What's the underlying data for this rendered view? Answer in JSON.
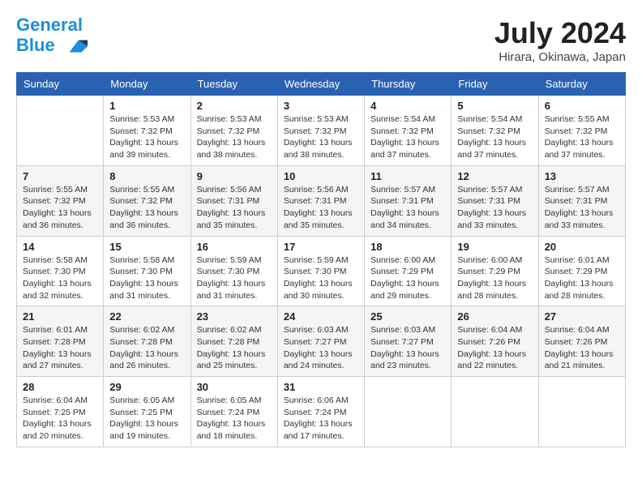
{
  "header": {
    "logo_line1": "General",
    "logo_line2": "Blue",
    "month": "July 2024",
    "location": "Hirara, Okinawa, Japan"
  },
  "weekdays": [
    "Sunday",
    "Monday",
    "Tuesday",
    "Wednesday",
    "Thursday",
    "Friday",
    "Saturday"
  ],
  "weeks": [
    [
      {
        "day": "",
        "info": ""
      },
      {
        "day": "1",
        "info": "Sunrise: 5:53 AM\nSunset: 7:32 PM\nDaylight: 13 hours\nand 39 minutes."
      },
      {
        "day": "2",
        "info": "Sunrise: 5:53 AM\nSunset: 7:32 PM\nDaylight: 13 hours\nand 38 minutes."
      },
      {
        "day": "3",
        "info": "Sunrise: 5:53 AM\nSunset: 7:32 PM\nDaylight: 13 hours\nand 38 minutes."
      },
      {
        "day": "4",
        "info": "Sunrise: 5:54 AM\nSunset: 7:32 PM\nDaylight: 13 hours\nand 37 minutes."
      },
      {
        "day": "5",
        "info": "Sunrise: 5:54 AM\nSunset: 7:32 PM\nDaylight: 13 hours\nand 37 minutes."
      },
      {
        "day": "6",
        "info": "Sunrise: 5:55 AM\nSunset: 7:32 PM\nDaylight: 13 hours\nand 37 minutes."
      }
    ],
    [
      {
        "day": "7",
        "info": "Sunrise: 5:55 AM\nSunset: 7:32 PM\nDaylight: 13 hours\nand 36 minutes."
      },
      {
        "day": "8",
        "info": "Sunrise: 5:55 AM\nSunset: 7:32 PM\nDaylight: 13 hours\nand 36 minutes."
      },
      {
        "day": "9",
        "info": "Sunrise: 5:56 AM\nSunset: 7:31 PM\nDaylight: 13 hours\nand 35 minutes."
      },
      {
        "day": "10",
        "info": "Sunrise: 5:56 AM\nSunset: 7:31 PM\nDaylight: 13 hours\nand 35 minutes."
      },
      {
        "day": "11",
        "info": "Sunrise: 5:57 AM\nSunset: 7:31 PM\nDaylight: 13 hours\nand 34 minutes."
      },
      {
        "day": "12",
        "info": "Sunrise: 5:57 AM\nSunset: 7:31 PM\nDaylight: 13 hours\nand 33 minutes."
      },
      {
        "day": "13",
        "info": "Sunrise: 5:57 AM\nSunset: 7:31 PM\nDaylight: 13 hours\nand 33 minutes."
      }
    ],
    [
      {
        "day": "14",
        "info": "Sunrise: 5:58 AM\nSunset: 7:30 PM\nDaylight: 13 hours\nand 32 minutes."
      },
      {
        "day": "15",
        "info": "Sunrise: 5:58 AM\nSunset: 7:30 PM\nDaylight: 13 hours\nand 31 minutes."
      },
      {
        "day": "16",
        "info": "Sunrise: 5:59 AM\nSunset: 7:30 PM\nDaylight: 13 hours\nand 31 minutes."
      },
      {
        "day": "17",
        "info": "Sunrise: 5:59 AM\nSunset: 7:30 PM\nDaylight: 13 hours\nand 30 minutes."
      },
      {
        "day": "18",
        "info": "Sunrise: 6:00 AM\nSunset: 7:29 PM\nDaylight: 13 hours\nand 29 minutes."
      },
      {
        "day": "19",
        "info": "Sunrise: 6:00 AM\nSunset: 7:29 PM\nDaylight: 13 hours\nand 28 minutes."
      },
      {
        "day": "20",
        "info": "Sunrise: 6:01 AM\nSunset: 7:29 PM\nDaylight: 13 hours\nand 28 minutes."
      }
    ],
    [
      {
        "day": "21",
        "info": "Sunrise: 6:01 AM\nSunset: 7:28 PM\nDaylight: 13 hours\nand 27 minutes."
      },
      {
        "day": "22",
        "info": "Sunrise: 6:02 AM\nSunset: 7:28 PM\nDaylight: 13 hours\nand 26 minutes."
      },
      {
        "day": "23",
        "info": "Sunrise: 6:02 AM\nSunset: 7:28 PM\nDaylight: 13 hours\nand 25 minutes."
      },
      {
        "day": "24",
        "info": "Sunrise: 6:03 AM\nSunset: 7:27 PM\nDaylight: 13 hours\nand 24 minutes."
      },
      {
        "day": "25",
        "info": "Sunrise: 6:03 AM\nSunset: 7:27 PM\nDaylight: 13 hours\nand 23 minutes."
      },
      {
        "day": "26",
        "info": "Sunrise: 6:04 AM\nSunset: 7:26 PM\nDaylight: 13 hours\nand 22 minutes."
      },
      {
        "day": "27",
        "info": "Sunrise: 6:04 AM\nSunset: 7:26 PM\nDaylight: 13 hours\nand 21 minutes."
      }
    ],
    [
      {
        "day": "28",
        "info": "Sunrise: 6:04 AM\nSunset: 7:25 PM\nDaylight: 13 hours\nand 20 minutes."
      },
      {
        "day": "29",
        "info": "Sunrise: 6:05 AM\nSunset: 7:25 PM\nDaylight: 13 hours\nand 19 minutes."
      },
      {
        "day": "30",
        "info": "Sunrise: 6:05 AM\nSunset: 7:24 PM\nDaylight: 13 hours\nand 18 minutes."
      },
      {
        "day": "31",
        "info": "Sunrise: 6:06 AM\nSunset: 7:24 PM\nDaylight: 13 hours\nand 17 minutes."
      },
      {
        "day": "",
        "info": ""
      },
      {
        "day": "",
        "info": ""
      },
      {
        "day": "",
        "info": ""
      }
    ]
  ]
}
